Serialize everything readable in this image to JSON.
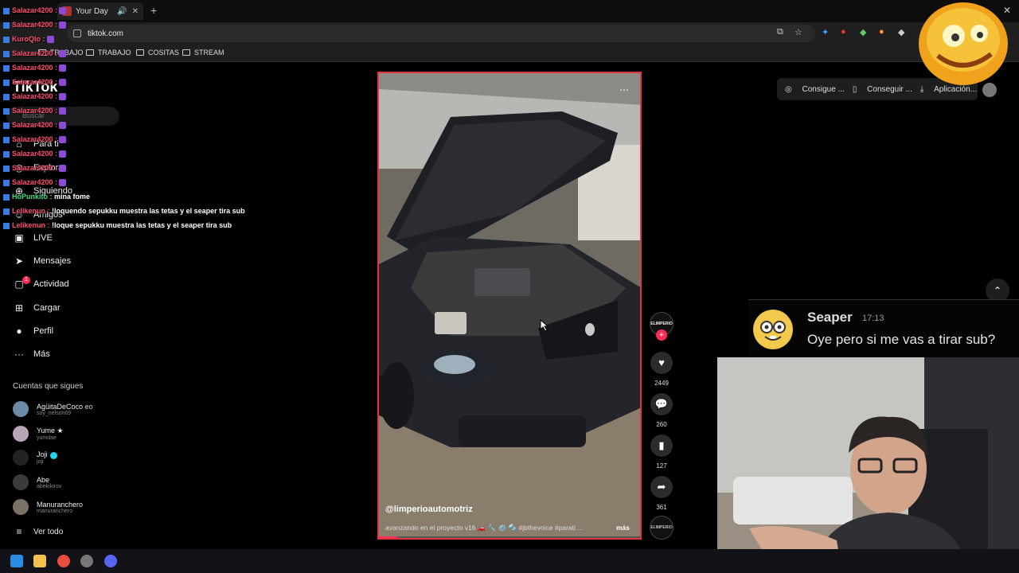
{
  "browser": {
    "tab_title": "Your Day",
    "url": "tiktok.com",
    "bookmarks": [
      "TRABAJO",
      "TRABAJO",
      "COSITAS",
      "STREAM"
    ]
  },
  "tiktok": {
    "logo": "TikTok",
    "search_placeholder": "Buscar",
    "nav": [
      "Para ti",
      "Explorar",
      "Siguiendo",
      "Amigos",
      "LIVE",
      "Mensajes",
      "Actividad",
      "Cargar",
      "Perfil",
      "Más"
    ],
    "notification_count": "1",
    "following_header": "Cuentas que sigues",
    "accounts": [
      {
        "name": "AgüitaDeCoco",
        "user": "soy_nelson69",
        "tag": "eo"
      },
      {
        "name": "Yume ★",
        "user": "yumdae"
      },
      {
        "name": "Joji",
        "user": "joji"
      },
      {
        "name": "Abe",
        "user": "abekikirov"
      },
      {
        "name": "Manuranchero",
        "user": "manuranchero"
      }
    ],
    "see_all": "Ver todo",
    "top_buttons": [
      "Consigue ...",
      "Conseguir ...",
      "Aplicación..."
    ],
    "video": {
      "author": "@limperioautomotriz",
      "description": "avanzando en el proyecto v16 🚗 🔧 ⚙️ 🔩 #jbthevoice #parati ...",
      "more": "más",
      "progress": 0.07
    },
    "creator_badge": "ELIMPERIO",
    "actions": {
      "likes": "2449",
      "comments": "260",
      "saves": "127",
      "shares": "361"
    }
  },
  "chat_overlay": [
    {
      "user": "Salazar4200 :",
      "color": "#ff4d6d",
      "msg": ""
    },
    {
      "user": "Salazar4200 :",
      "color": "#ff4d6d",
      "msg": ""
    },
    {
      "user": "KuroQlo :",
      "color": "#ff4d6d",
      "msg": ""
    },
    {
      "user": "Salazar4200 :",
      "color": "#ff4d6d",
      "msg": ""
    },
    {
      "user": "Salazar4200 :",
      "color": "#ff4d6d",
      "msg": ""
    },
    {
      "user": "Salazar4200 :",
      "color": "#ff4d6d",
      "msg": ""
    },
    {
      "user": "Salazar4200 :",
      "color": "#ff4d6d",
      "msg": ""
    },
    {
      "user": "Salazar4200 :",
      "color": "#ff4d6d",
      "msg": ""
    },
    {
      "user": "Salazar4200 :",
      "color": "#ff4d6d",
      "msg": ""
    },
    {
      "user": "Salazar4200 :",
      "color": "#ff4d6d",
      "msg": ""
    },
    {
      "user": "Salazar4200 :",
      "color": "#ff4d6d",
      "msg": ""
    },
    {
      "user": "Salazar4200 :",
      "color": "#ff4d6d",
      "msg": ""
    },
    {
      "user": "Salazar4200 :",
      "color": "#ff4d6d",
      "msg": ""
    },
    {
      "user": "HoPunkito :",
      "color": "#3ddc84",
      "msg": "mina fome"
    },
    {
      "user": "Lelikenun :",
      "color": "#ff4d6d",
      "msg": "!loquendo sepukku muestra las tetas y el seaper tira sub"
    },
    {
      "user": "Lelikenun :",
      "color": "#ff4d6d",
      "msg": "!loque sepukku muestra las tetas y el seaper tira sub"
    }
  ],
  "stream_alert": {
    "user": "Seaper",
    "time": "17:13",
    "text": "Oye pero si me vas a tirar sub?"
  },
  "colors": {
    "accent": "#fe2c55",
    "video_border": "#e0343e"
  }
}
